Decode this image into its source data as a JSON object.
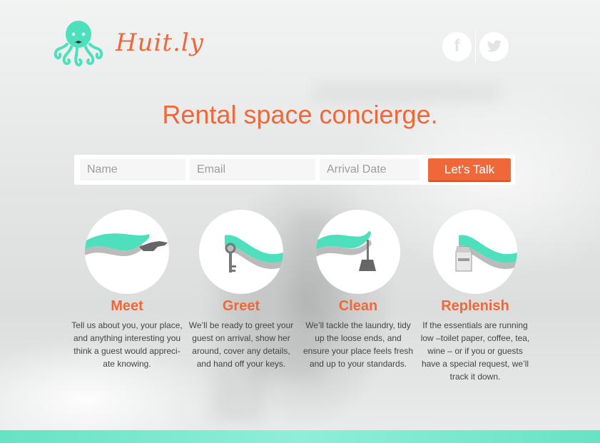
{
  "brand": {
    "name": "Huit.ly",
    "logo_icon": "octopus-icon"
  },
  "social": [
    {
      "icon": "facebook-icon",
      "glyph": "f"
    },
    {
      "icon": "twitter-icon",
      "glyph": ""
    }
  ],
  "headline": "Rental space concierge.",
  "form": {
    "name_placeholder": "Name",
    "email_placeholder": "Email",
    "date_placeholder": "Arrival Date",
    "submit_label": "Let’s Talk"
  },
  "features": [
    {
      "title": "Meet",
      "icon": "handshake-icon",
      "description": "Tell us about you, your place, and anything interesting you think a guest would appreci-ate knowing."
    },
    {
      "title": "Greet",
      "icon": "key-icon",
      "description": "We’ll be ready to greet your guest on arrival, show her around, cover any details, and hand off your keys."
    },
    {
      "title": "Clean",
      "icon": "broom-icon",
      "description": "We’ll tackle the laundry, tidy up the loose ends, and ensure your place feels fresh and up to your standards."
    },
    {
      "title": "Replenish",
      "icon": "coffee-bag-icon",
      "description": "If the essentials are running low –toilet paper, coffee, tea, wine – or if you or guests have a special request, we’ll track it down."
    }
  ],
  "colors": {
    "accent": "#f0683a",
    "teal": "#4ee0bd",
    "white": "#ffffff"
  }
}
